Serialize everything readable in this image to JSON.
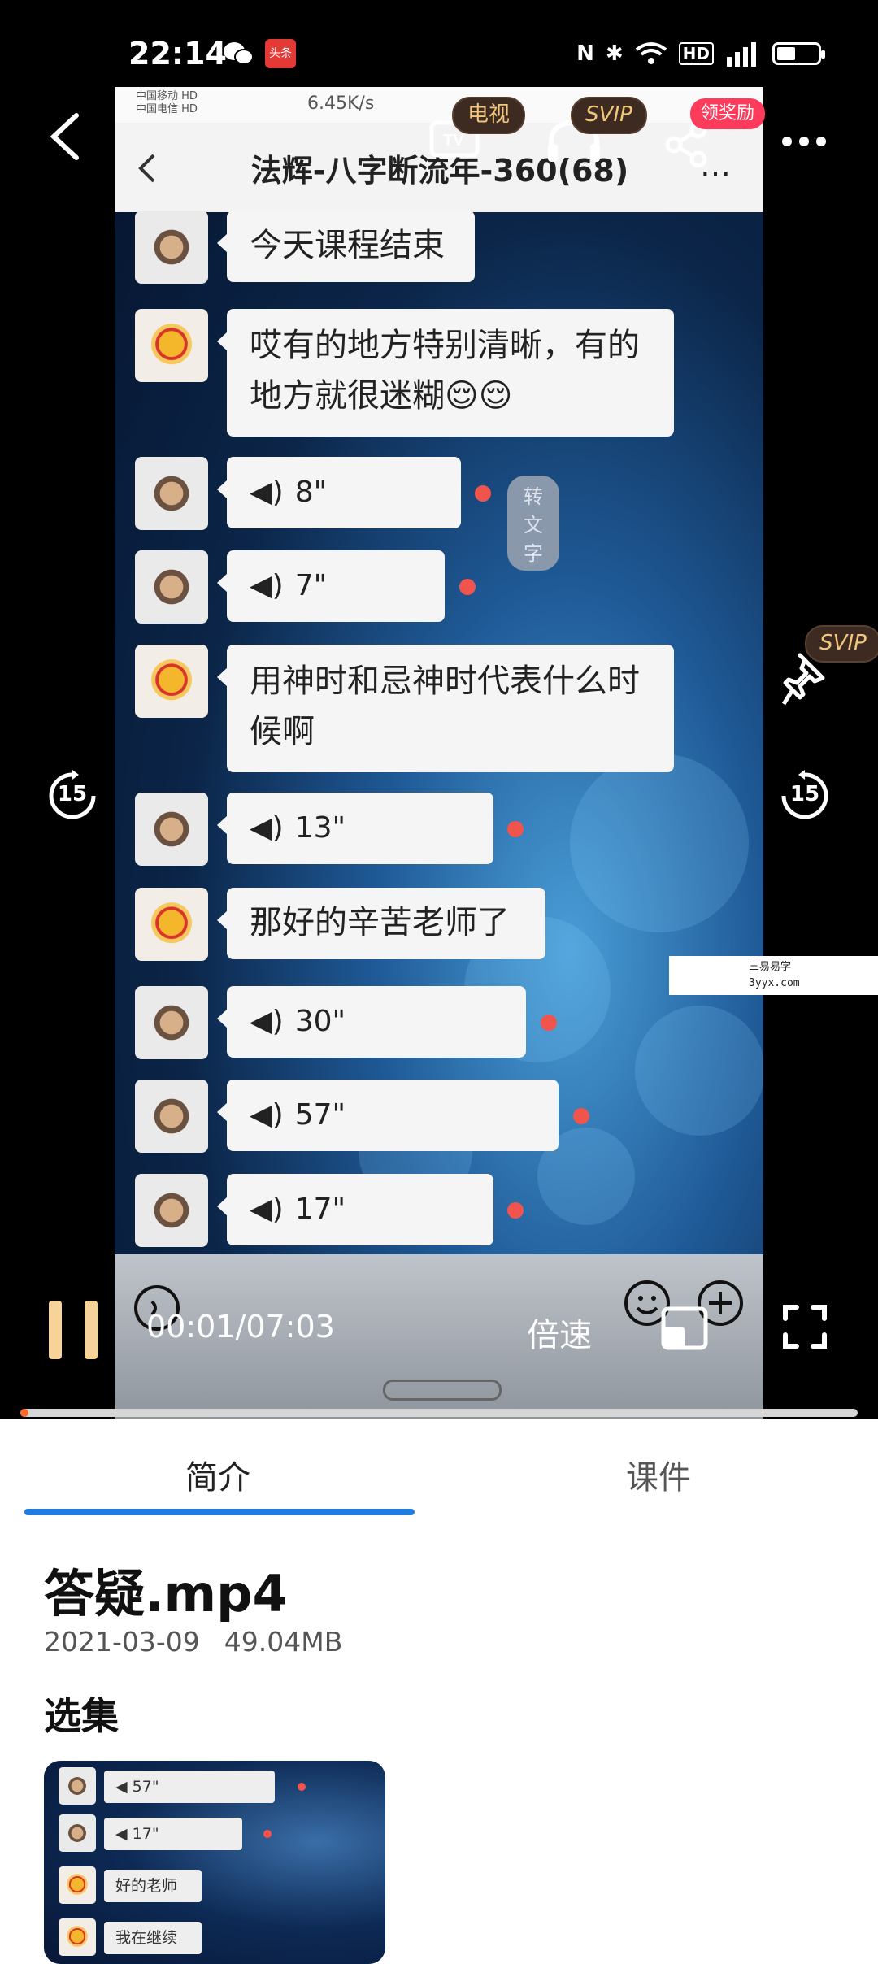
{
  "statusbar": {
    "time": "22:14",
    "badge": "头条"
  },
  "inner": {
    "status_left": "中国移动 HD\n中国电信 HD",
    "status_speed": "6.45K/s",
    "title": "法辉-八字断流年-360(68)",
    "messages": [
      {
        "type": "text",
        "avatar": "cat",
        "text": "今天课程结束"
      },
      {
        "type": "text",
        "avatar": "bear",
        "text": "哎有的地方特别清晰，有的地方就很迷糊😌😌"
      },
      {
        "type": "voice",
        "avatar": "cat",
        "duration": "8\"",
        "extra": "转文字"
      },
      {
        "type": "voice",
        "avatar": "cat",
        "duration": "7\""
      },
      {
        "type": "text",
        "avatar": "bear",
        "text": "用神时和忌神时代表什么时候啊"
      },
      {
        "type": "voice",
        "avatar": "cat",
        "duration": "13\""
      },
      {
        "type": "text",
        "avatar": "bear",
        "text": "那好的辛苦老师了"
      },
      {
        "type": "voice",
        "avatar": "cat",
        "duration": "30\""
      },
      {
        "type": "voice",
        "avatar": "cat",
        "duration": "57\""
      },
      {
        "type": "voice",
        "avatar": "cat",
        "duration": "17\""
      }
    ]
  },
  "player": {
    "tv_label": "电视",
    "svip_label": "SVIP",
    "reward_label": "领奖励",
    "skip_back": "15",
    "skip_forward": "15",
    "time": "00:01/07:03",
    "speed_label": "倍速",
    "progress": 0.01,
    "watermark_line1": "三易易学",
    "watermark_line2": "3yyx.com"
  },
  "tabs": {
    "intro": "简介",
    "files": "课件"
  },
  "file": {
    "title": "答疑.mp4",
    "date": "2021-03-09",
    "size": "49.04MB"
  },
  "episodes": {
    "heading": "选集",
    "thumb_rows": [
      {
        "avatar": "cat",
        "text": "◀ 57\""
      },
      {
        "avatar": "cat",
        "text": "◀ 17\""
      },
      {
        "avatar": "bear",
        "text": "好的老师"
      },
      {
        "avatar": "bear",
        "text": "我在继续"
      }
    ]
  },
  "colors": {
    "accent": "#1f7ce3",
    "progress": "#ff6a2a",
    "svip_text": "#f2c77c",
    "unread_dot": "#f0544c"
  }
}
